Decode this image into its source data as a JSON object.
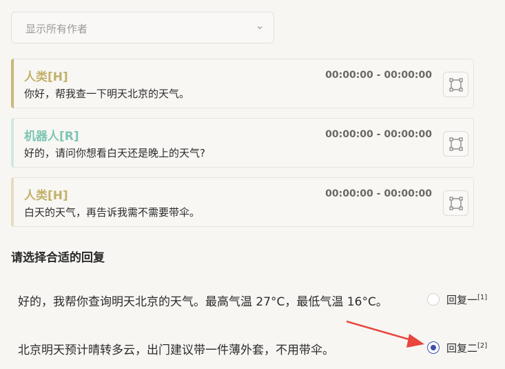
{
  "filter": {
    "selected": "显示所有作者"
  },
  "messages": [
    {
      "role": "人类[H]",
      "time": "00:00:00 - 00:00:00",
      "text": "你好，帮我查一下明天北京的天气。",
      "color": "#c2b16a"
    },
    {
      "role": "机器人[R]",
      "time": "00:00:00 - 00:00:00",
      "text": "好的，请问你想看白天还是晚上的天气?",
      "color": "#7dc5b4"
    },
    {
      "role": "人类[H]",
      "time": "00:00:00 - 00:00:00",
      "text": "白天的天气，再告诉我需不需要带伞。",
      "color": "#c2b16a"
    }
  ],
  "section": {
    "title": "请选择合适的回复"
  },
  "options": [
    {
      "text": "好的，我帮你查询明天北京的天气。最高气温 27°C，最低气温 16°C。",
      "label": "回复一",
      "ref": "[1]",
      "selected": false
    },
    {
      "text": "北京明天预计晴转多云，出门建议带一件薄外套，不用带伞。",
      "label": "回复二",
      "ref": "[2]",
      "selected": true
    }
  ],
  "colors": {
    "accent": "#3d4fa8",
    "arrow": "#e8463e",
    "bar_light": "#e6dcc0",
    "bar_mint": "#cfe9e2"
  }
}
